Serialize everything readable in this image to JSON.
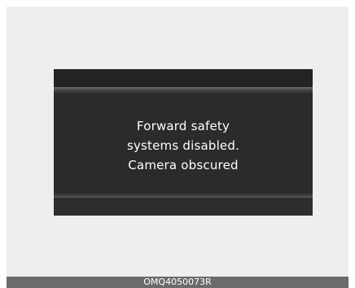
{
  "display": {
    "message_lines": [
      "Forward safety",
      "systems disabled.",
      "Camera obscured"
    ]
  },
  "caption": {
    "code": "OMQ4050073R"
  }
}
